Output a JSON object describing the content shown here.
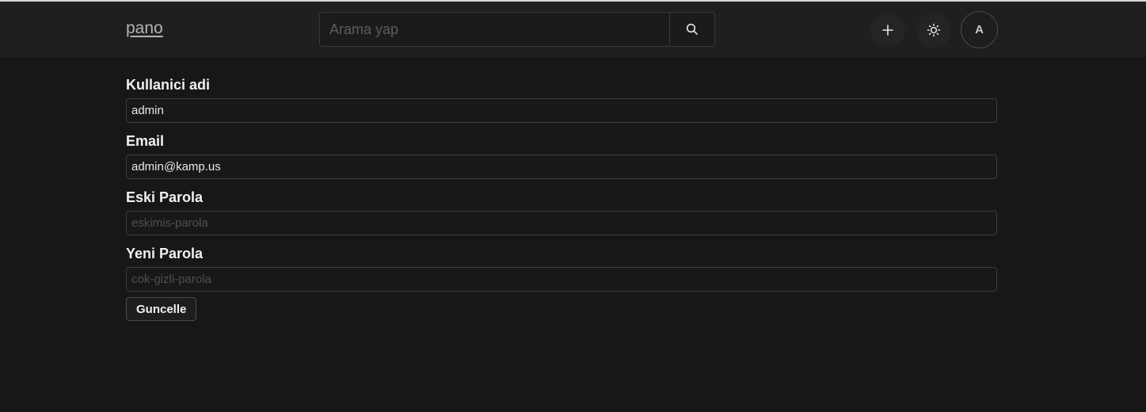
{
  "header": {
    "logo": "pano",
    "search": {
      "placeholder": "Arama yap",
      "icon": "search-icon"
    },
    "add_icon": "plus-icon",
    "theme_icon": "sun-icon",
    "avatar_initial": "A"
  },
  "form": {
    "username": {
      "label": "Kullanici adi",
      "value": "admin"
    },
    "email": {
      "label": "Email",
      "value": "admin@kamp.us"
    },
    "old_password": {
      "label": "Eski Parola",
      "placeholder": "eskimis-parola"
    },
    "new_password": {
      "label": "Yeni Parola",
      "placeholder": "cok-gizli-parola"
    },
    "submit_label": "Guncelle"
  }
}
